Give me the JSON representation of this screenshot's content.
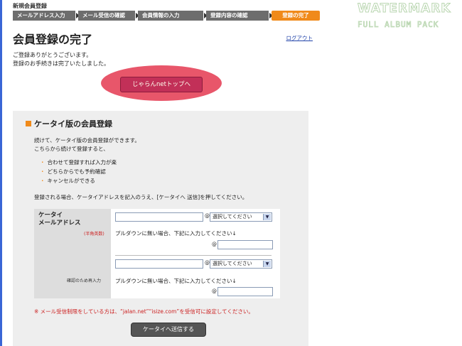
{
  "header": {
    "section_title": "新規会員登録",
    "steps": [
      "メールアドレス入力",
      "メール受信の確認",
      "会員情報の入力",
      "登録内容の確認",
      "登録の完了"
    ],
    "active_step": 4
  },
  "page": {
    "title": "会員登録の完了",
    "logout": "ログアウト",
    "thanks_lines": [
      "ご登録ありがとうございます。",
      "登録のお手続きは完了いたしました。"
    ],
    "top_button": "じゃらんnetトップへ"
  },
  "mobile": {
    "heading": "ケータイ版の会員登録",
    "intro_lines": [
      "続けて、ケータイ版の会員登録ができます。",
      "こちらから続けて登録すると、"
    ],
    "bullets": [
      "合わせて登録すれば入力が楽",
      "どちらからでも予約確認",
      "キャンセルができる"
    ],
    "instruction": "登録される場合、ケータイアドレスを記入のうえ、[ケータイへ 送信]を押してください。",
    "label_line1": "ケータイ",
    "label_line2": "メールアドレス",
    "label_note": "(半角英数)",
    "confirm_label": "確認のため再入力",
    "at": "@",
    "select_value": "選択してください",
    "help_text": "プルダウンに無い場合、下記に入力してください↓",
    "warning": "※ メール受信制限をしている方は、“jalan.net”“isize.com”を受信可に設定してください。",
    "send_button": "ケータイへ送信する"
  },
  "watermark": {
    "line1": "WATERMARK",
    "line2": "FULL ALBUM PACK"
  },
  "colors": {
    "accent_orange": "#f08a1a",
    "step_gray": "#6d6d6d",
    "highlight_pink": "#e8566a",
    "button_magenta": "#c23058",
    "warning_red": "#cc2222"
  }
}
